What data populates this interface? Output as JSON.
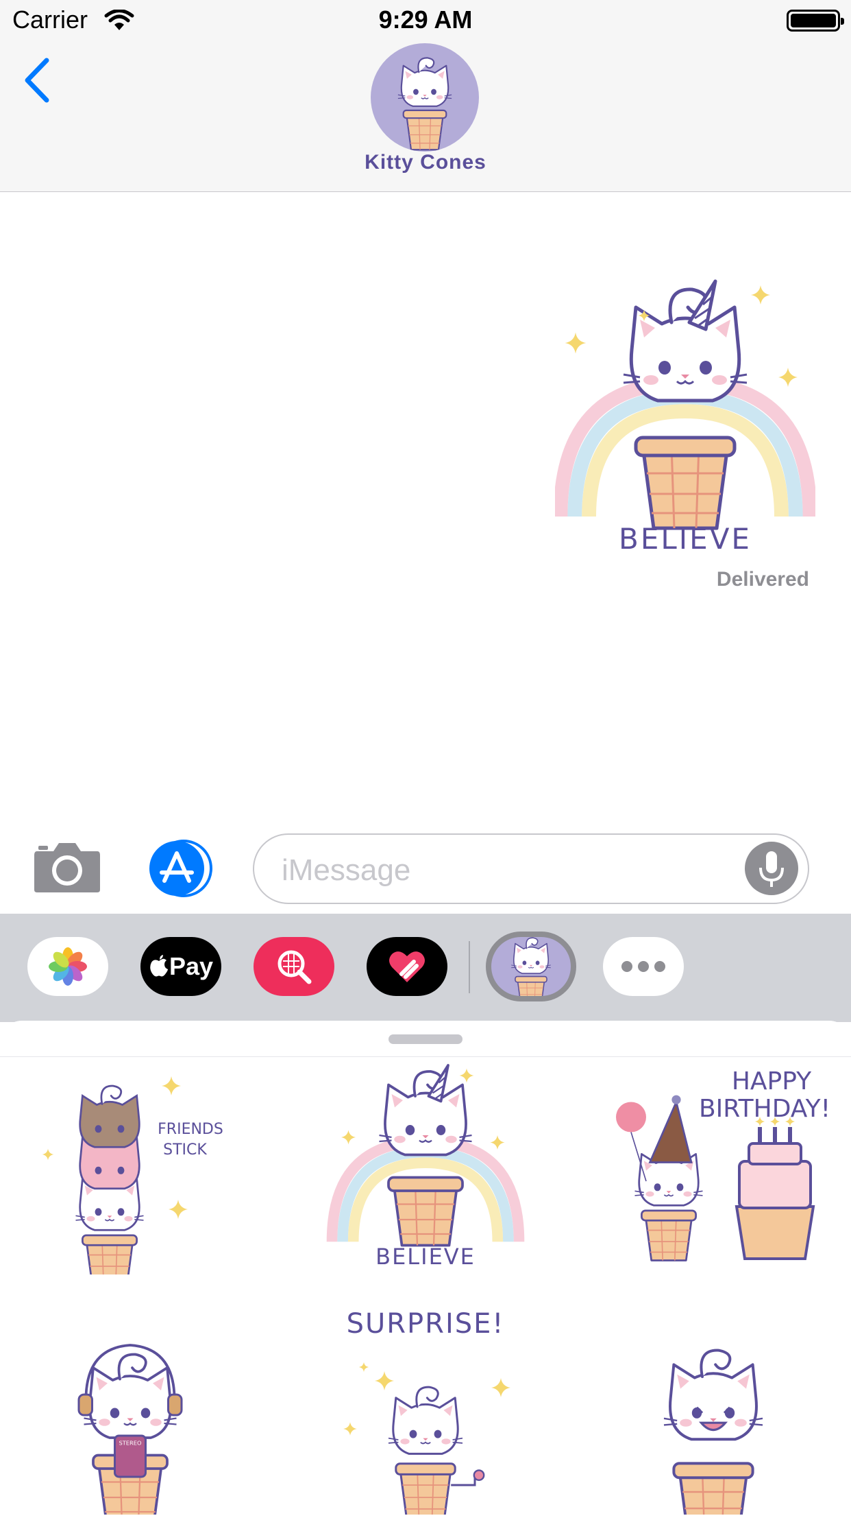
{
  "status_bar": {
    "carrier": "Carrier",
    "time": "9:29 AM"
  },
  "header": {
    "contact_name": "Kitty Cones",
    "back_icon": "chevron-left-icon"
  },
  "conversation": {
    "sent_sticker": {
      "caption": "BELIEVE"
    },
    "status": "Delivered"
  },
  "compose": {
    "placeholder": "iMessage",
    "camera_icon": "camera-icon",
    "appstore_icon": "app-store-icon",
    "mic_icon": "microphone-icon"
  },
  "app_drawer": {
    "apps": [
      {
        "name": "Photos",
        "icon": "photos-icon"
      },
      {
        "name": "Pay",
        "icon": "apple-pay-icon"
      },
      {
        "name": "Search",
        "icon": "image-search-icon"
      },
      {
        "name": "Digital Touch",
        "icon": "digital-touch-icon"
      },
      {
        "name": "Kitty Cones",
        "icon": "kitty-cones-icon"
      },
      {
        "name": "More",
        "icon": "more-icon"
      }
    ],
    "pay_label": "Pay"
  },
  "stickers": [
    {
      "name": "friends-stick",
      "caption": "FRIENDS STICK",
      "line1": "FRIENDS",
      "line2": "STICK"
    },
    {
      "name": "believe",
      "caption": "BELIEVE"
    },
    {
      "name": "happy-birthday",
      "caption": "HAPPY BIRTHDAY!",
      "line1": "HAPPY",
      "line2": "BIRTHDAY!"
    },
    {
      "name": "music",
      "caption": "",
      "tape_label": "STEREO"
    },
    {
      "name": "surprise",
      "caption": "SURPRISE!"
    },
    {
      "name": "laughing",
      "caption": ""
    }
  ],
  "colors": {
    "accent": "#007aff",
    "kitty_purple": "#5a4f9a",
    "avatar_bg": "#b3acd8",
    "cone": "#f4c89a",
    "search_app": "#ee2e5b"
  }
}
